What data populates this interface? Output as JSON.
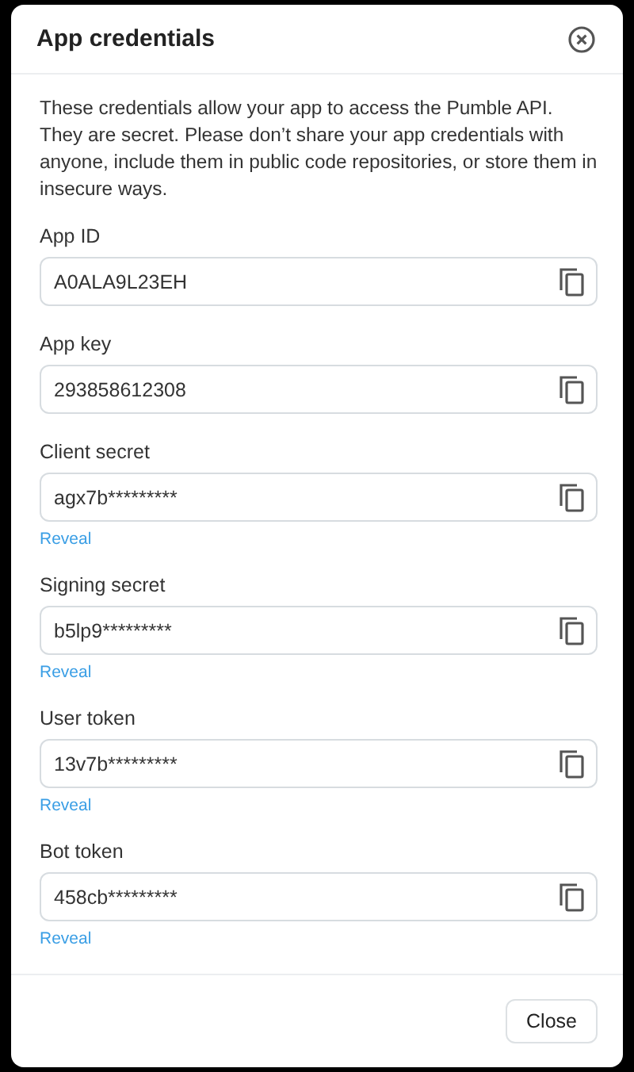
{
  "dialog": {
    "title": "App credentials",
    "description": "These credentials allow your app to access the Pumble API. They are secret. Please don’t share your app credentials with anyone, include them in public code repositories, or store them in insecure ways.",
    "fields": [
      {
        "label": "App ID",
        "value": "A0ALA9L23EH"
      },
      {
        "label": "App key",
        "value": "293858612308"
      },
      {
        "label": "Client secret",
        "value": "agx7b*********",
        "reveal": "Reveal"
      },
      {
        "label": "Signing secret",
        "value": "b5lp9*********",
        "reveal": "Reveal"
      },
      {
        "label": "User token",
        "value": "13v7b*********",
        "reveal": "Reveal"
      },
      {
        "label": "Bot token",
        "value": "458cb*********",
        "reveal": "Reveal"
      }
    ],
    "close_button": "Close"
  }
}
